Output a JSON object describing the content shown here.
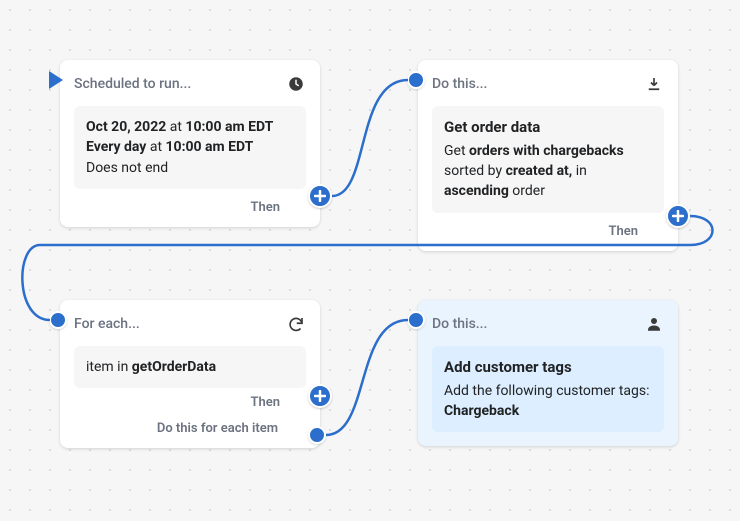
{
  "card1": {
    "title": "Scheduled to run...",
    "body_date_prefix": "Oct 20, 2022",
    "body_at": " at ",
    "body_time1": "10:00 am EDT",
    "body_every": "Every day",
    "body_time2": "10:00 am EDT",
    "body_noend": "Does not end",
    "then": "Then"
  },
  "card2": {
    "title": "Do this...",
    "body_title": "Get order data",
    "body_l1a": "Get ",
    "body_l1b": "orders with chargebacks",
    "body_l2a": "sorted by ",
    "body_l2b": "created at,",
    "body_l2c": " in",
    "body_l3a": "ascending",
    "body_l3b": " order",
    "then": "Then"
  },
  "card3": {
    "title": "For each...",
    "body_a": "item in ",
    "body_b": "getOrderData",
    "then": "Then",
    "each": "Do this for each item"
  },
  "card4": {
    "title": "Do this...",
    "body_title": "Add customer tags",
    "body_l1": "Add the following customer tags:",
    "body_l2": "Chargeback"
  }
}
